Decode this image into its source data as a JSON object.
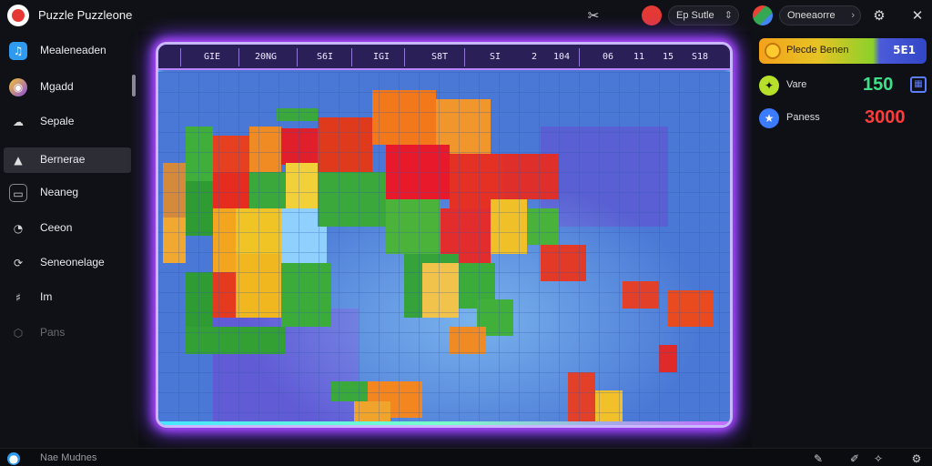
{
  "app": {
    "title": "Puzzle Puzzleone"
  },
  "topbar": {
    "pill_one_label": "Ep Sutle",
    "pill_two_label": "Oneeaorre",
    "accent_red": "#e53935",
    "icons": [
      "tools-icon",
      "settings-icon",
      "close-icon"
    ]
  },
  "sidebar": {
    "items": [
      {
        "label": "Mealeneaden",
        "icon": "music-icon",
        "active": false
      },
      {
        "label": "Mgadd",
        "icon": "globe-icon",
        "active": false
      },
      {
        "label": "Sepale",
        "icon": "cloud-icon",
        "active": false
      },
      {
        "label": "Bernerae",
        "icon": "user-icon",
        "active": true
      },
      {
        "label": "Neaneg",
        "icon": "image-icon",
        "active": false
      },
      {
        "label": "Ceeon",
        "icon": "chat-icon",
        "active": false
      },
      {
        "label": "Seneonelage",
        "icon": "reload-icon",
        "active": false
      },
      {
        "label": "Im",
        "icon": "tag-icon",
        "active": false
      },
      {
        "label": "Pans",
        "icon": "box-icon",
        "active": false
      }
    ]
  },
  "board": {
    "ruler_ticks": [
      "GIE",
      "20NG",
      "S6I",
      "IGI",
      "S8T",
      "SI",
      "2",
      "104",
      "06",
      "11",
      "15",
      "S18"
    ],
    "ocean_color": "#4a78d6",
    "frame_glow": "#b24bff"
  },
  "right_panel": {
    "score_label": "Plecde Benen",
    "score_value": "5E1",
    "row_one_label": "Vare",
    "row_one_value": "150",
    "row_one_color": "#3fe08a",
    "row_two_label": "Paness",
    "row_two_value": "3000",
    "row_two_color": "#ff3b3b"
  },
  "bottombar": {
    "label": "Nae Mudnes"
  }
}
